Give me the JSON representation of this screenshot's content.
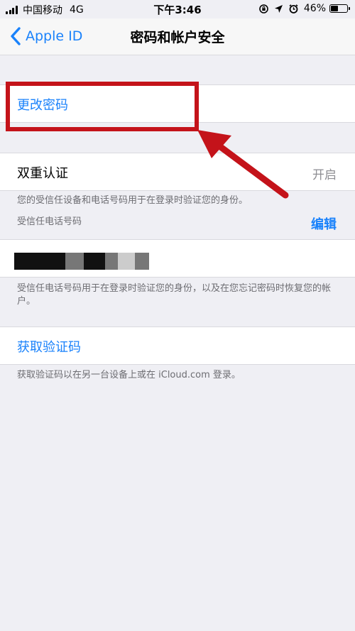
{
  "status_bar": {
    "carrier": "中国移动",
    "network": "4G",
    "time": "下午3:46",
    "battery": "46%",
    "battery_level": 0.46,
    "icons": [
      "signal-icon",
      "orientation-lock-icon",
      "location-icon",
      "alarm-icon",
      "battery-icon"
    ]
  },
  "nav": {
    "back_label": "Apple ID",
    "title": "密码和帐户安全"
  },
  "change_password": {
    "label": "更改密码"
  },
  "two_factor": {
    "label": "双重认证",
    "value": "开启",
    "description": "您的受信任设备和电话号码用于在登录时验证您的身份。",
    "trusted_header": "受信任电话号码",
    "edit_label": "编辑",
    "phone_footnote": "受信任电话号码用于在登录时验证您的身份，以及在您忘记密码时恢复您的帐户。"
  },
  "verification": {
    "label": "获取验证码",
    "footnote": "获取验证码以在另一台设备上或在 iCloud.com 登录。"
  },
  "colors": {
    "accent": "#1a82fb",
    "background": "#efeff4",
    "annotation": "#c4131a"
  }
}
